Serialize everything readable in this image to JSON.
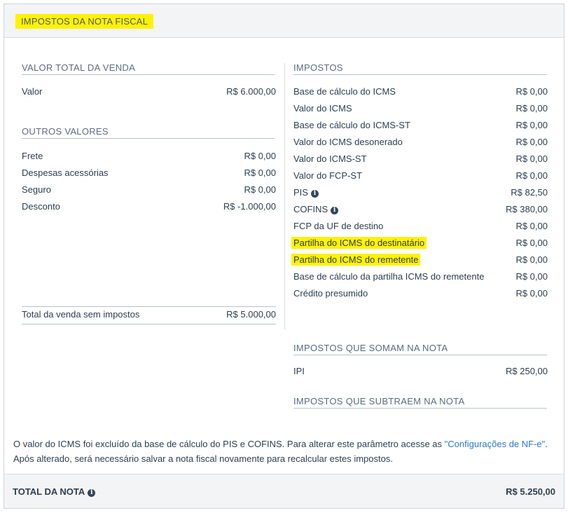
{
  "header": {
    "title": "IMPOSTOS DA NOTA FISCAL"
  },
  "left": {
    "venda_title": "VALOR TOTAL DA VENDA",
    "venda_rows": [
      {
        "label": "Valor",
        "value": "R$ 6.000,00"
      }
    ],
    "outros_title": "OUTROS VALORES",
    "outros_rows": [
      {
        "label": "Frete",
        "value": "R$ 0,00"
      },
      {
        "label": "Despesas acessórias",
        "value": "R$ 0,00"
      },
      {
        "label": "Seguro",
        "value": "R$ 0,00"
      },
      {
        "label": "Desconto",
        "value": "R$ -1.000,00"
      }
    ],
    "total": {
      "label": "Total da venda sem impostos",
      "value": "R$ 5.000,00"
    }
  },
  "right": {
    "impostos_title": "IMPOSTOS",
    "impostos_rows": [
      {
        "label": "Base de cálculo do ICMS",
        "value": "R$ 0,00"
      },
      {
        "label": "Valor do ICMS",
        "value": "R$ 0,00"
      },
      {
        "label": "Base de cálculo do ICMS-ST",
        "value": "R$ 0,00"
      },
      {
        "label": "Valor do ICMS desonerado",
        "value": "R$ 0,00"
      },
      {
        "label": "Valor do ICMS-ST",
        "value": "R$ 0,00"
      },
      {
        "label": "Valor do FCP-ST",
        "value": "R$ 0,00"
      },
      {
        "label": "PIS",
        "value": "R$ 82,50"
      },
      {
        "label": "COFINS",
        "value": "R$ 380,00"
      },
      {
        "label": "FCP da UF de destino",
        "value": "R$ 0,00"
      },
      {
        "label": "Partilha do ICMS do destinatário",
        "value": "R$ 0,00"
      },
      {
        "label": "Partilha do ICMS do remetente",
        "value": "R$ 0,00"
      },
      {
        "label": "Base de cálculo da partilha ICMS do remetente",
        "value": "R$ 0,00"
      },
      {
        "label": "Crédito presumido",
        "value": "R$ 0,00"
      }
    ],
    "somam_title": "IMPOSTOS QUE SOMAM NA NOTA",
    "somam_rows": [
      {
        "label": "IPI",
        "value": "R$ 250,00"
      }
    ],
    "subtraem_title": "IMPOSTOS QUE SUBTRAEM NA NOTA"
  },
  "note": {
    "text_before": "O valor do ICMS foi excluído da base de cálculo do PIS e COFINS. Para alterar este parâmetro acesse as ",
    "link": "\"Configurações de NF-e\"",
    "text_after": ". Após alterado, será necessário salvar a nota fiscal novamente para recalcular estes impostos."
  },
  "footer": {
    "label": "TOTAL DA NOTA",
    "value": "R$ 5.250,00"
  },
  "icons": {
    "info": "info-icon"
  },
  "colors": {
    "highlight": "#fff200",
    "link": "#2a7ac9",
    "text": "#2d3e50"
  }
}
